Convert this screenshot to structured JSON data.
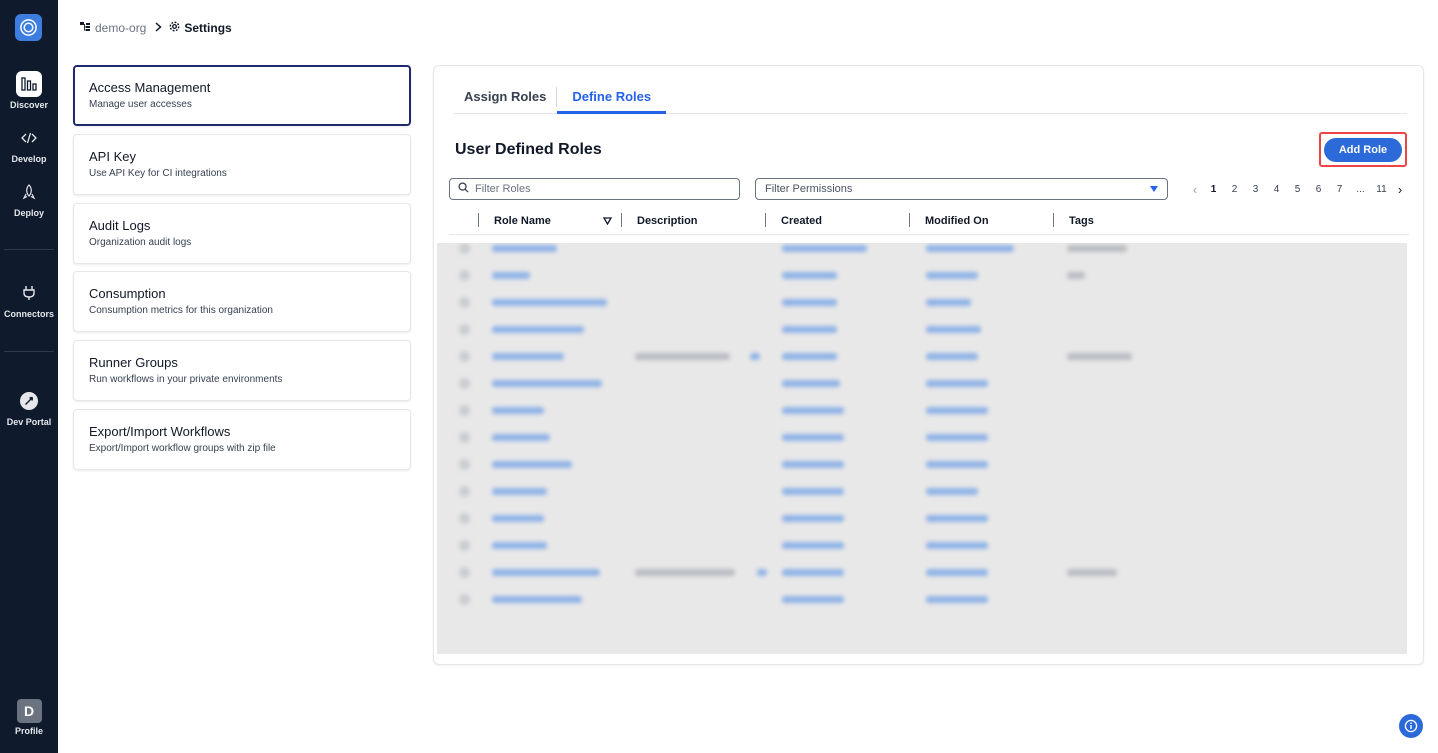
{
  "rail": {
    "items": [
      {
        "label": "Discover",
        "icon": "discover-icon"
      },
      {
        "label": "Develop",
        "icon": "code-icon"
      },
      {
        "label": "Deploy",
        "icon": "deploy-icon"
      },
      {
        "label": "Connectors",
        "icon": "plug-icon"
      },
      {
        "label": "Dev Portal",
        "icon": "rocket-icon"
      }
    ],
    "profile": {
      "initial": "D",
      "label": "Profile"
    }
  },
  "breadcrumb": {
    "org": "demo-org",
    "current": "Settings"
  },
  "settings_menu": [
    {
      "title": "Access Management",
      "desc": "Manage user accesses"
    },
    {
      "title": "API Key",
      "desc": "Use API Key for CI integrations"
    },
    {
      "title": "Audit Logs",
      "desc": "Organization audit logs"
    },
    {
      "title": "Consumption",
      "desc": "Consumption metrics for this organization"
    },
    {
      "title": "Runner Groups",
      "desc": "Run workflows in your private environments"
    },
    {
      "title": "Export/Import Workflows",
      "desc": "Export/Import workflow groups with zip file"
    }
  ],
  "tabs": [
    "Assign Roles",
    "Define Roles"
  ],
  "active_tab": "Define Roles",
  "section": {
    "title": "User Defined Roles",
    "add_button": "Add Role"
  },
  "filters": {
    "roles_placeholder": "Filter Roles",
    "permissions_placeholder": "Filter Permissions"
  },
  "pagination": {
    "pages": [
      "1",
      "2",
      "3",
      "4",
      "5",
      "6",
      "7",
      "...",
      "11"
    ],
    "current": "1"
  },
  "table": {
    "columns": [
      "Role Name",
      "Description",
      "Created",
      "Modified On",
      "Tags"
    ]
  },
  "colors": {
    "rail_bg": "#0f1b2d",
    "accent": "#2b6ad8",
    "active_card_border": "#1f2a6b",
    "highlight": "#ef4444"
  }
}
